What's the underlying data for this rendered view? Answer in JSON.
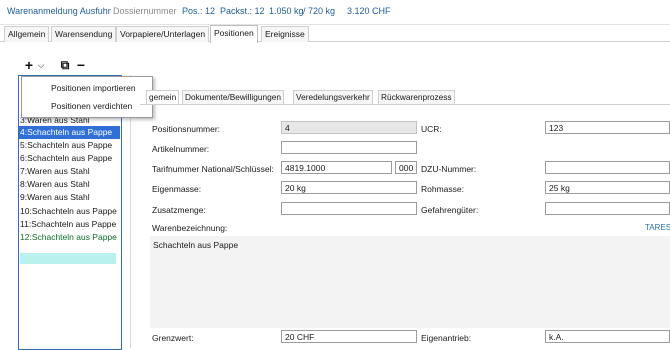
{
  "title": {
    "app": "Warenanmeldung Ausfuhr",
    "dossier": "Dossiernummer",
    "pos": "Pos.: 12",
    "packst": "Packst.: 12",
    "weight": "1.050 kg",
    "weight2": "/ 720 kg",
    "value": "3.120 CHF"
  },
  "main_tabs": [
    "Allgemein",
    "Warensendung",
    "Vorpapiere/Unterlagen",
    "Positionen",
    "Ereignisse"
  ],
  "toolbar": {
    "add": "+",
    "dropdown": "⌵",
    "copy": "⧉",
    "remove": "−"
  },
  "menu": {
    "items": [
      "Positionen importieren",
      "Positionen verdichten"
    ]
  },
  "positions": [
    {
      "label": "3:Waren aus Stahl"
    },
    {
      "label": "4:Schachteln aus Pappe"
    },
    {
      "label": "5:Schachteln aus Pappe"
    },
    {
      "label": "6:Schachteln aus Pappe"
    },
    {
      "label": "7:Waren aus Stahl"
    },
    {
      "label": "8:Waren aus Stahl"
    },
    {
      "label": "9:Waren aus Stahl"
    },
    {
      "label": "10:Schachteln aus Pappe"
    },
    {
      "label": "11:Schachteln aus Pappe"
    },
    {
      "label": "12:Schachteln aus Pappe"
    }
  ],
  "selected_position": "4:Schachteln aus Pappe",
  "sub_tabs": [
    "gemein",
    "Dokumente/Bewilligungen",
    "Veredelungsverkehr",
    "Rückwarenprozess"
  ],
  "form": {
    "positionsnummer": {
      "label": "Positionsnummer:",
      "value": "4"
    },
    "artikelnummer": {
      "label": "Artikelnummer:",
      "value": ""
    },
    "tarifnummer": {
      "label": "Tarifnummer National/Schlüssel:",
      "value": "4819.1000",
      "key": "000"
    },
    "eigenmasse": {
      "label": "Eigenmasse:",
      "value": "20 kg"
    },
    "zusatzmenge": {
      "label": "Zusatzmenge:",
      "value": ""
    },
    "ucr": {
      "label": "UCR:",
      "value": "123"
    },
    "dzu": {
      "label": "DZU-Nummer:",
      "value": ""
    },
    "rohmasse": {
      "label": "Rohmasse:",
      "value": "25 kg"
    },
    "gefahrengueter": {
      "label": "Gefahrengüter:",
      "value": ""
    },
    "warenbezeichnung": {
      "label": "Warenbezeichnung:",
      "value": "Schachteln aus Pappe"
    },
    "tares_link": "TARES",
    "grenzwert": {
      "label": "Grenzwert:",
      "value": "20 CHF"
    },
    "eigenantrieb": {
      "label": "Eigenantrieb:",
      "value": "k.A."
    }
  },
  "colors": {
    "accent": "#1f5d99",
    "selection": "#2f6fd6",
    "green_text": "#0e6e2a",
    "highlight": "#b9f1ee"
  }
}
